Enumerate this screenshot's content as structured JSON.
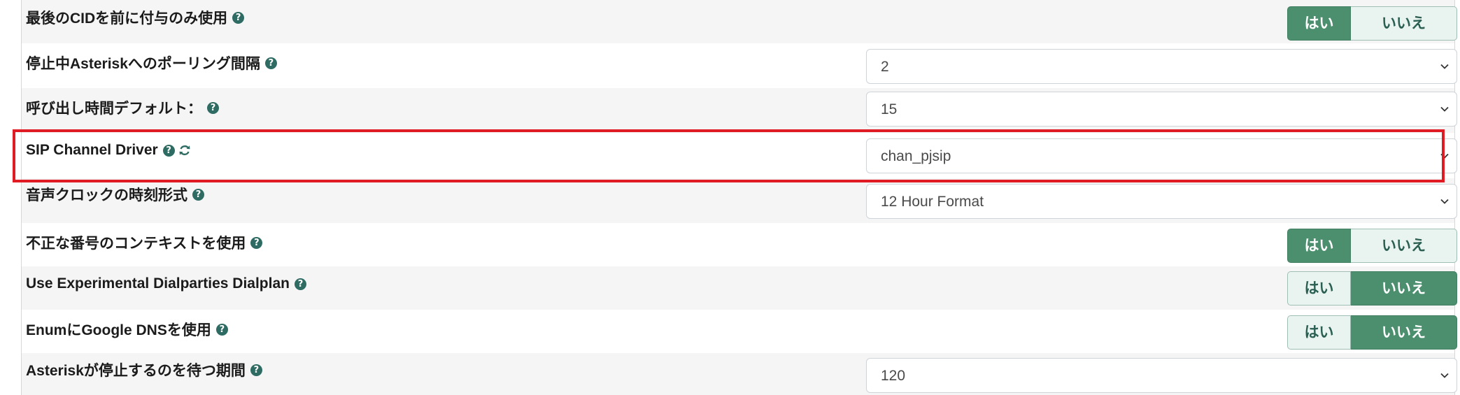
{
  "settings": {
    "rows": [
      {
        "label": "最後のCIDを前に付与のみ使用",
        "type": "toggle",
        "yes": "はい",
        "no": "いいえ",
        "selected": "yes"
      },
      {
        "label": "停止中Asteriskへのポーリング間隔",
        "type": "select",
        "value": "2"
      },
      {
        "label": "呼び出し時間デフォルト：",
        "type": "select",
        "value": "15"
      },
      {
        "label": "SIP Channel Driver",
        "type": "select",
        "value": "chan_pjsip",
        "reload_icon": "refresh-icon"
      },
      {
        "label": "音声クロックの時刻形式",
        "type": "select",
        "value": "12 Hour Format"
      },
      {
        "label": "不正な番号のコンテキストを使用",
        "type": "toggle",
        "yes": "はい",
        "no": "いいえ",
        "selected": "yes"
      },
      {
        "label": "Use Experimental Dialparties Dialplan",
        "type": "toggle",
        "yes": "はい",
        "no": "いいえ",
        "selected": "no"
      },
      {
        "label": "EnumにGoogle DNSを使用",
        "type": "toggle",
        "yes": "はい",
        "no": "いいえ",
        "selected": "no"
      },
      {
        "label": "Asteriskが停止するのを待つ期間",
        "type": "select",
        "value": "120"
      }
    ]
  },
  "icons": {
    "help": "help-question-icon",
    "select_arrow": "chevron-down-icon",
    "reload": "refresh-icon"
  },
  "colors": {
    "toggle_on": "#4b8f6e",
    "toggle_off": "#e9f3ef",
    "help_icon": "#2e6b62",
    "highlight_border": "#e01b24"
  }
}
